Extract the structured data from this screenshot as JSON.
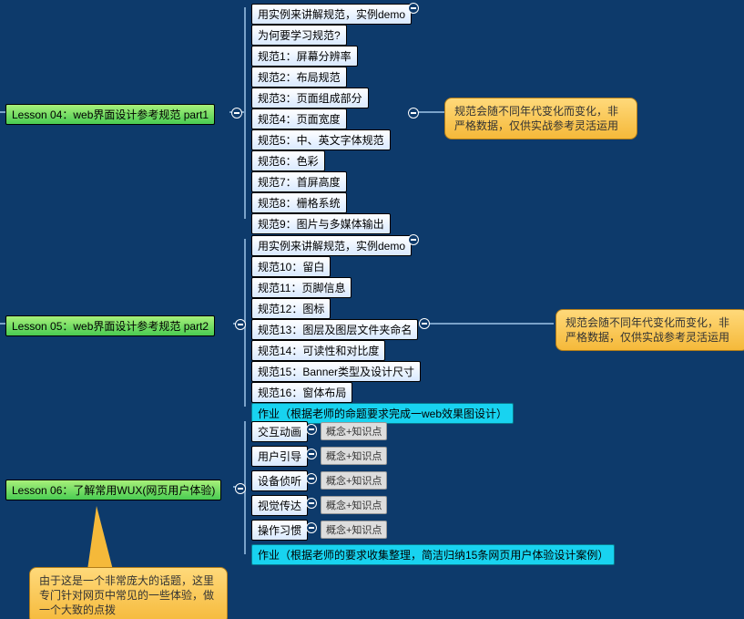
{
  "lessons": [
    {
      "label": "Lesson 04：web界面设计参考规范 part1"
    },
    {
      "label": "Lesson 05：web界面设计参考规范  part2"
    },
    {
      "label": "Lesson 06：了解常用WUX(网页用户体验)"
    }
  ],
  "l4_items": [
    "用实例来讲解规范，实例demo",
    "为何要学习规范?",
    "规范1：屏幕分辨率",
    "规范2：布局规范",
    "规范3：页面组成部分",
    "规范4：页面宽度",
    "规范5：中、英文字体规范",
    "规范6：色彩",
    "规范7：首屏高度",
    "规范8：栅格系统",
    "规范9：图片与多媒体输出"
  ],
  "l5_items": [
    "用实例来讲解规范，实例demo",
    "规范10：留白",
    "规范11：页脚信息",
    "规范12：图标",
    "规范13：图层及图层文件夹命名",
    "规范14：可读性和对比度",
    "规范15：Banner类型及设计尺寸",
    "规范16：窗体布局"
  ],
  "l5_hw": "作业（根据老师的命题要求完成一web效果图设计）",
  "l6_items": [
    "交互动画",
    "用户引导",
    "设备侦听",
    "视觉传达",
    "操作习惯"
  ],
  "l6_tag": "概念+知识点",
  "l6_hw": "作业（根据老师的要求收集整理，简洁归纳15条网页用户体验设计案例）",
  "callout_right": "规范会随不同年代变化而变化，非严格数据，仅供实战参考灵活运用",
  "callout_bottom": "由于这是一个非常庞大的话题，这里专门针对网页中常见的一些体验，做一个大致的点拨"
}
